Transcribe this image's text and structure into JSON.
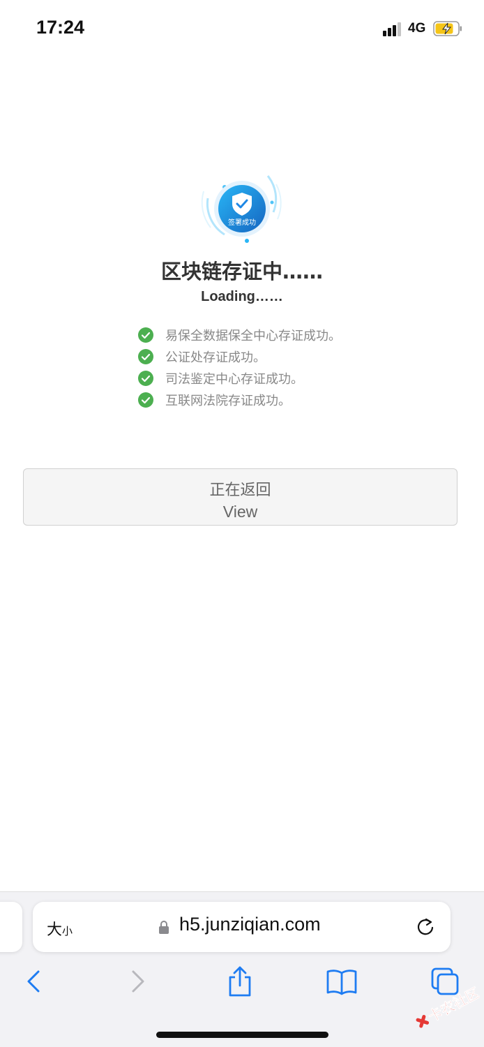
{
  "status_bar": {
    "time": "17:24",
    "network": "4G"
  },
  "page": {
    "badge_text": "签署成功",
    "title": "区块链存证中……",
    "subtitle": "Loading……",
    "steps": [
      "易保全数据保全中心存证成功。",
      "公证处存证成功。",
      "司法鉴定中心存证成功。",
      "互联网法院存证成功。"
    ],
    "action_button": {
      "line1": "正在返回",
      "line2": "View"
    }
  },
  "browser": {
    "text_size_big": "大",
    "text_size_small": "小",
    "url": "h5.junziqian.com"
  },
  "watermark": {
    "text": "卡农社区"
  },
  "colors": {
    "accent_blue": "#1E88E5",
    "check_green": "#4CAF50",
    "ios_blue": "#1E7CF2"
  }
}
